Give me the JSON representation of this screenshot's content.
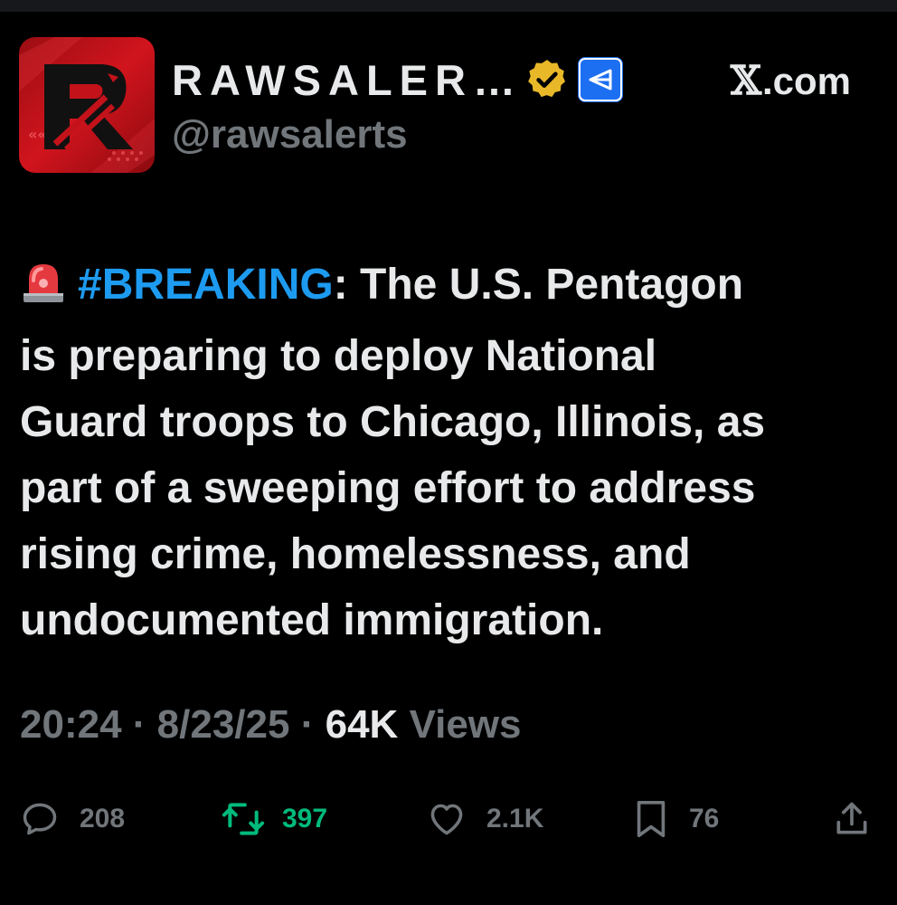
{
  "colors": {
    "background": "#000000",
    "text": "#e7e9ea",
    "muted": "#71767b",
    "link": "#1d9bf0",
    "retweet_active": "#00ba7c",
    "verified_gold": "#e8b829",
    "affiliate_blue": "#1d6ff2",
    "avatar_red": "#c4121a"
  },
  "header": {
    "display_name": "RAWSALER…",
    "handle": "@rawsalerts",
    "source": ".com",
    "avatar_letter": "R",
    "badges": [
      "verified-gold-icon",
      "affiliate-icon"
    ]
  },
  "tweet": {
    "emoji": "siren-icon",
    "hashtag": "#BREAKING",
    "lines": [
      ": The U.S. Pentagon",
      "is preparing to deploy National",
      "Guard troops to Chicago, Illinois, as",
      "part of a sweeping effort to address",
      "rising crime, homelessness, and",
      "undocumented immigration."
    ]
  },
  "meta": {
    "time": "20:24",
    "date": "8/23/25",
    "separator": "·",
    "views_count": "64K",
    "views_label": "Views"
  },
  "actions": {
    "replies": "208",
    "retweets": "397",
    "likes": "2.1K",
    "bookmarks": "76",
    "share_icon": "share-icon"
  }
}
